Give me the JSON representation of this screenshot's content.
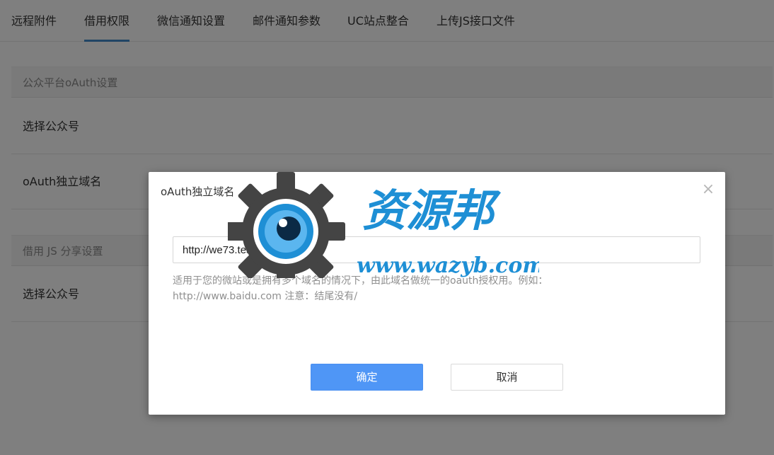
{
  "tabs": [
    {
      "label": "远程附件"
    },
    {
      "label": "借用权限",
      "active": true
    },
    {
      "label": "微信通知设置"
    },
    {
      "label": "邮件通知参数"
    },
    {
      "label": "UC站点整合"
    },
    {
      "label": "上传JS接口文件"
    }
  ],
  "sections": {
    "oauth": {
      "title": "公众平台oAuth设置",
      "row1": "选择公众号",
      "row2": "oAuth独立域名"
    },
    "js_share": {
      "title": "借用 JS 分享设置",
      "row1": "选择公众号"
    }
  },
  "modal": {
    "title": "oAuth独立域名",
    "input_value": "http://we73.test/aj.php#2b358",
    "help_line1": "适用于您的微站或是拥有多个域名的情况下，由此域名做统一的oauth授权用。例如：",
    "help_line2": "http://www.baidu.com 注意：结尾没有/",
    "confirm_label": "确定",
    "cancel_label": "取消",
    "close_glyph": "×"
  },
  "watermark": {
    "brand": "资源邦",
    "url": "www.wazyb.com",
    "gear_color": "#444444",
    "eye_color": "#1e8fd5"
  },
  "colors": {
    "accent": "#428bca",
    "primary_button": "#4f96f6"
  }
}
